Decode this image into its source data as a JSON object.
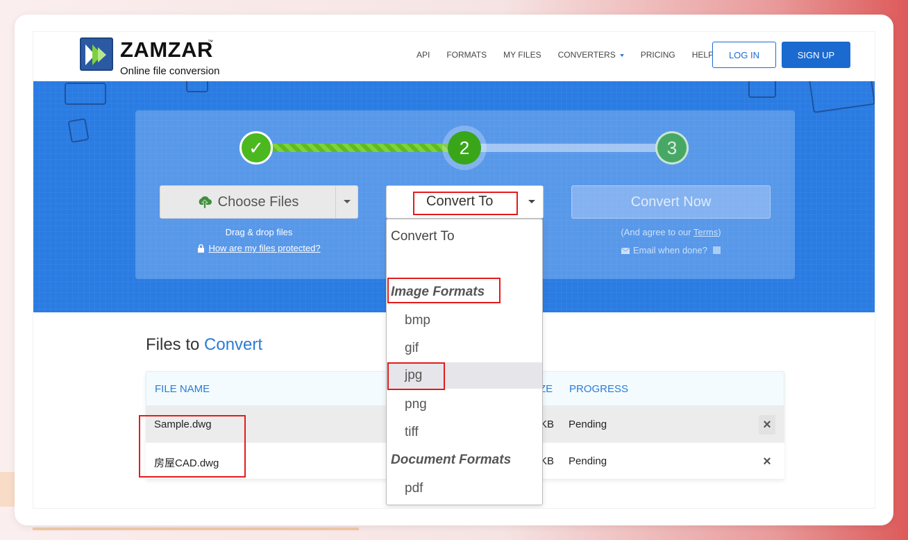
{
  "brand": {
    "name": "ZAMZAR",
    "trademark": "™",
    "tagline": "Online file conversion"
  },
  "nav": {
    "items": [
      {
        "label": "API"
      },
      {
        "label": "FORMATS"
      },
      {
        "label": "MY FILES"
      },
      {
        "label": "CONVERTERS"
      },
      {
        "label": "PRICING"
      },
      {
        "label": "HELP"
      }
    ],
    "login": "LOG IN",
    "signup": "SIGN UP"
  },
  "steps": {
    "step1": "✓",
    "step2": "2",
    "step3": "3",
    "progress_fraction": 0.52
  },
  "choose": {
    "label": "Choose Files",
    "drag_text": "Drag & drop files",
    "protect_link": "How are my files protected?"
  },
  "convert_to": {
    "label": "Convert To"
  },
  "convert_now": {
    "label": "Convert Now",
    "agree_prefix": "(And agree to our ",
    "terms": "Terms",
    "agree_suffix": ")",
    "email_label": "Email when done?"
  },
  "dropdown": {
    "header": "Convert To",
    "group_image": "Image Formats",
    "options_image": [
      "bmp",
      "gif",
      "jpg",
      "png",
      "tiff"
    ],
    "group_document": "Document Formats",
    "options_document": [
      "pdf"
    ],
    "highlighted": "jpg"
  },
  "files": {
    "title_plain": "Files to ",
    "title_accent": "Convert",
    "col_name": "FILE NAME",
    "col_size_partial": "ZE",
    "col_progress": "PROGRESS",
    "rows": [
      {
        "name": "Sample.dwg",
        "size_partial": "KB",
        "progress": "Pending",
        "remove": "×"
      },
      {
        "name": "房屋CAD.dwg",
        "size_partial": "KB",
        "progress": "Pending",
        "remove": "×"
      }
    ]
  },
  "colors": {
    "accent": "#1a6ad0",
    "hero_blue": "#2a7ce3",
    "step_green": "#4cb81f",
    "annotation_red": "#e31b1b"
  }
}
